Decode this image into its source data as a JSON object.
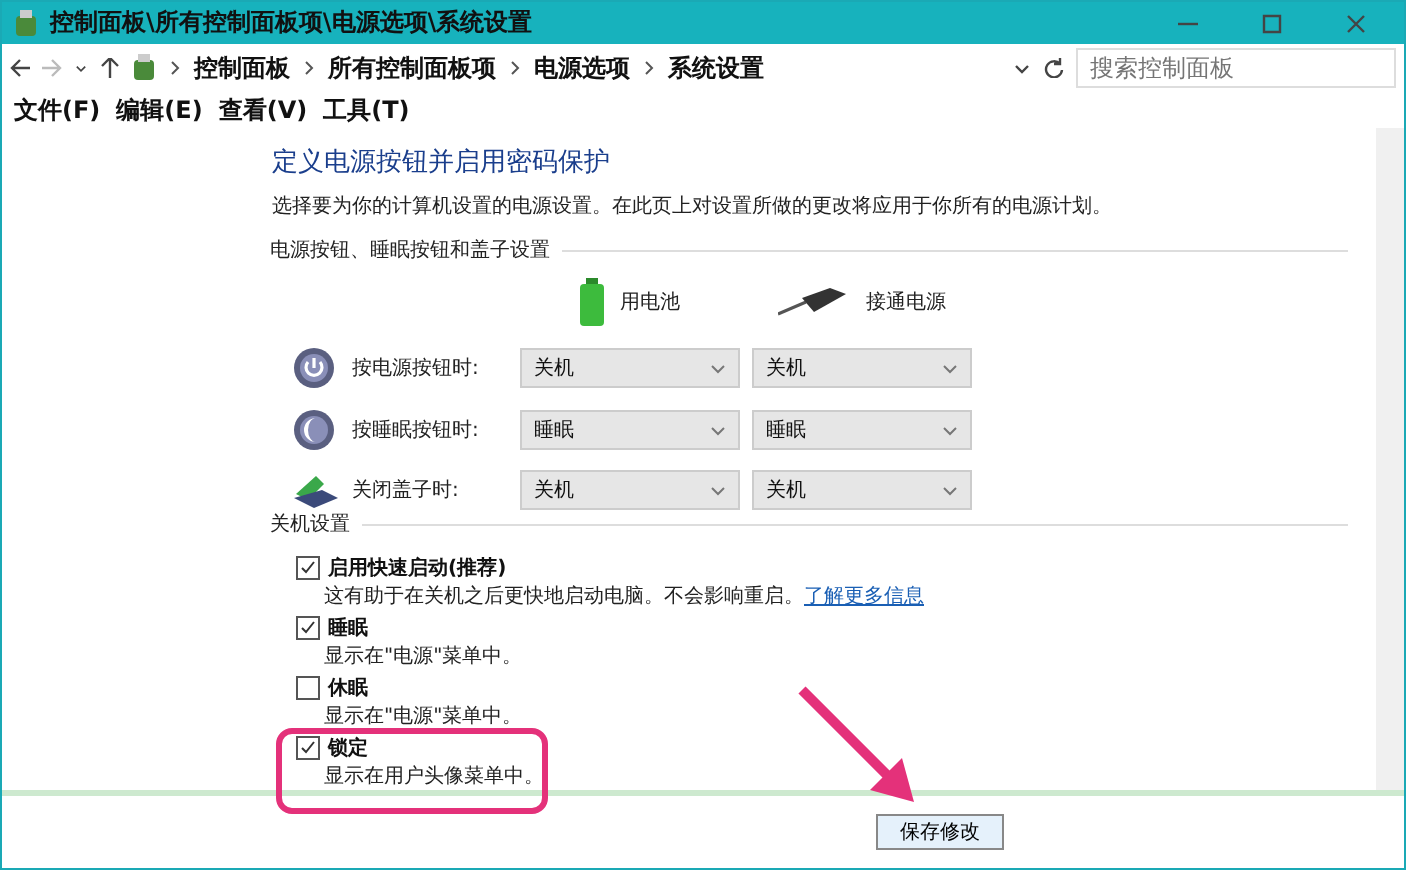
{
  "window": {
    "title": "控制面板\\所有控制面板项\\电源选项\\系统设置"
  },
  "address_bar": {
    "crumbs": [
      "控制面板",
      "所有控制面板项",
      "电源选项",
      "系统设置"
    ],
    "search_placeholder": "搜索控制面板"
  },
  "menu": [
    "文件(F)",
    "编辑(E)",
    "查看(V)",
    "工具(T)"
  ],
  "heading": "定义电源按钮并启用密码保护",
  "description": "选择要为你的计算机设置的电源设置。在此页上对设置所做的更改将应用于你所有的电源计划。",
  "button_section": {
    "label": "电源按钮、睡眠按钮和盖子设置",
    "columns": [
      {
        "kind": "battery",
        "label": "用电池"
      },
      {
        "kind": "plug",
        "label": "接通电源"
      }
    ],
    "rows": [
      {
        "kind": "power",
        "label": "按电源按钮时:",
        "battery": "关机",
        "plugged": "关机"
      },
      {
        "kind": "sleep",
        "label": "按睡眠按钮时:",
        "battery": "睡眠",
        "plugged": "睡眠"
      },
      {
        "kind": "lid",
        "label": "关闭盖子时:",
        "battery": "关机",
        "plugged": "关机"
      }
    ]
  },
  "shutdown_section": {
    "label": "关机设置",
    "options": [
      {
        "label": "启用快速启动(推荐)",
        "checked": true,
        "note": "这有助于在关机之后更快地启动电脑。不会影响重启。",
        "link": "了解更多信息"
      },
      {
        "label": "睡眠",
        "checked": true,
        "note": "显示在\"电源\"菜单中。"
      },
      {
        "label": "休眠",
        "checked": false,
        "note": "显示在\"电源\"菜单中。"
      },
      {
        "label": "锁定",
        "checked": true,
        "note": "显示在用户头像菜单中。",
        "highlighted": true
      }
    ]
  },
  "save_button": "保存修改"
}
